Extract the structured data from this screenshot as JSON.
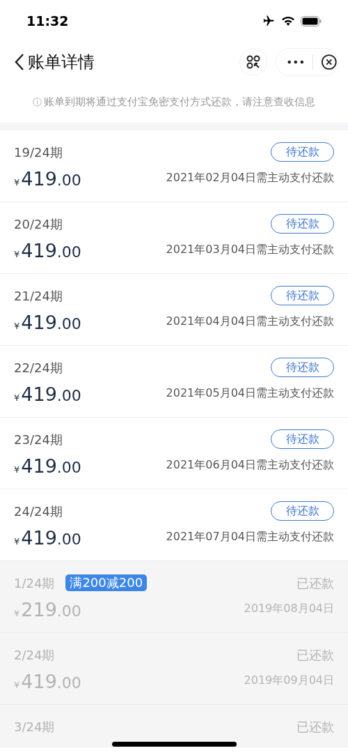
{
  "status_bar": {
    "time": "11:32"
  },
  "nav": {
    "title": "账单详情"
  },
  "notice": {
    "icon": "ⓘ",
    "text": "账单到期将通过支付宝免密支付方式还款，请注意查收信息"
  },
  "installments": [
    {
      "kind": "pending",
      "period": "19/24期",
      "status": "待还款",
      "currency": "¥",
      "integer": "419",
      "decimal": ".00",
      "note": "2021年02月04日需主动支付还款"
    },
    {
      "kind": "pending",
      "period": "20/24期",
      "status": "待还款",
      "currency": "¥",
      "integer": "419",
      "decimal": ".00",
      "note": "2021年03月04日需主动支付还款"
    },
    {
      "kind": "pending",
      "period": "21/24期",
      "status": "待还款",
      "currency": "¥",
      "integer": "419",
      "decimal": ".00",
      "note": "2021年04月04日需主动支付还款"
    },
    {
      "kind": "pending",
      "period": "22/24期",
      "status": "待还款",
      "currency": "¥",
      "integer": "419",
      "decimal": ".00",
      "note": "2021年05月04日需主动支付还款"
    },
    {
      "kind": "pending",
      "period": "23/24期",
      "status": "待还款",
      "currency": "¥",
      "integer": "419",
      "decimal": ".00",
      "note": "2021年06月04日需主动支付还款"
    },
    {
      "kind": "pending",
      "period": "24/24期",
      "status": "待还款",
      "currency": "¥",
      "integer": "419",
      "decimal": ".00",
      "note": "2021年07月04日需主动支付还款"
    },
    {
      "kind": "paid",
      "period": "1/24期",
      "tag": "满200减200",
      "status": "已还款",
      "currency": "¥",
      "integer": "219",
      "decimal": ".00",
      "note": "2019年08月04日"
    },
    {
      "kind": "paid",
      "period": "2/24期",
      "status": "已还款",
      "currency": "¥",
      "integer": "419",
      "decimal": ".00",
      "note": "2019年09月04日"
    },
    {
      "kind": "paid",
      "period": "3/24期",
      "status": "已还款"
    }
  ]
}
